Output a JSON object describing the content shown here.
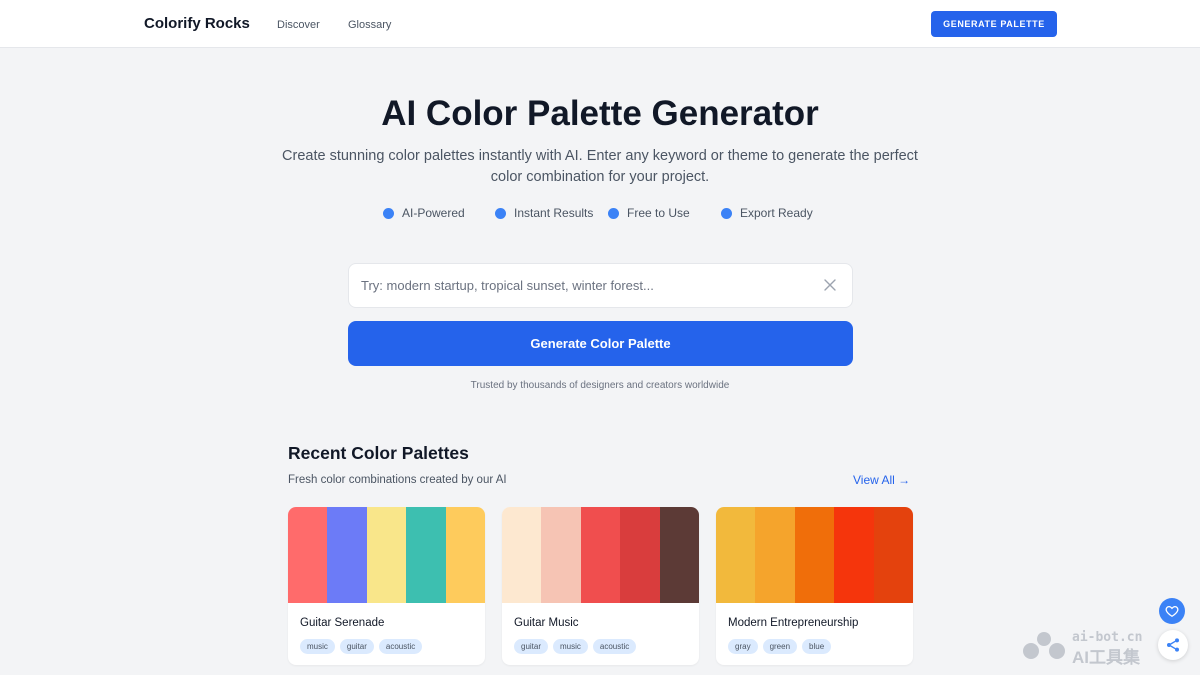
{
  "nav": {
    "brand": "Colorify Rocks",
    "links": [
      "Discover",
      "Glossary"
    ],
    "cta": "GENERATE PALETTE"
  },
  "hero": {
    "title": "AI Color Palette Generator",
    "subtitle": "Create stunning color palettes instantly with AI. Enter any keyword or theme to generate the perfect color combination for your project.",
    "features": [
      "AI-Powered",
      "Instant Results",
      "Free to Use",
      "Export Ready"
    ]
  },
  "search": {
    "placeholder": "Try: modern startup, tropical sunset, winter forest...",
    "value": "",
    "button": "Generate Color Palette",
    "trusted": "Trusted by thousands of designers and creators worldwide"
  },
  "recent": {
    "title": "Recent Color Palettes",
    "subtitle": "Fresh color combinations created by our AI",
    "view_all": "View All →",
    "palettes": [
      {
        "name": "Guitar Serenade",
        "colors": [
          "#ff6b6b",
          "#6c7bf7",
          "#f9e68a",
          "#3dbfb0",
          "#fecb5c"
        ],
        "tags": [
          "music",
          "guitar",
          "acoustic"
        ]
      },
      {
        "name": "Guitar Music",
        "colors": [
          "#fde8d0",
          "#f6c4b4",
          "#f04e4e",
          "#d93d3d",
          "#5c3a36"
        ],
        "tags": [
          "guitar",
          "music",
          "acoustic"
        ]
      },
      {
        "name": "Modern Entrepreneurship",
        "colors": [
          "#f2b93c",
          "#f5a42c",
          "#f06e0a",
          "#f5350c",
          "#e4420d"
        ],
        "tags": [
          "gray",
          "green",
          "blue"
        ]
      }
    ]
  },
  "watermark": {
    "url": "ai-bot.cn",
    "text": "AI工具集"
  },
  "accent_color": "#2563eb"
}
